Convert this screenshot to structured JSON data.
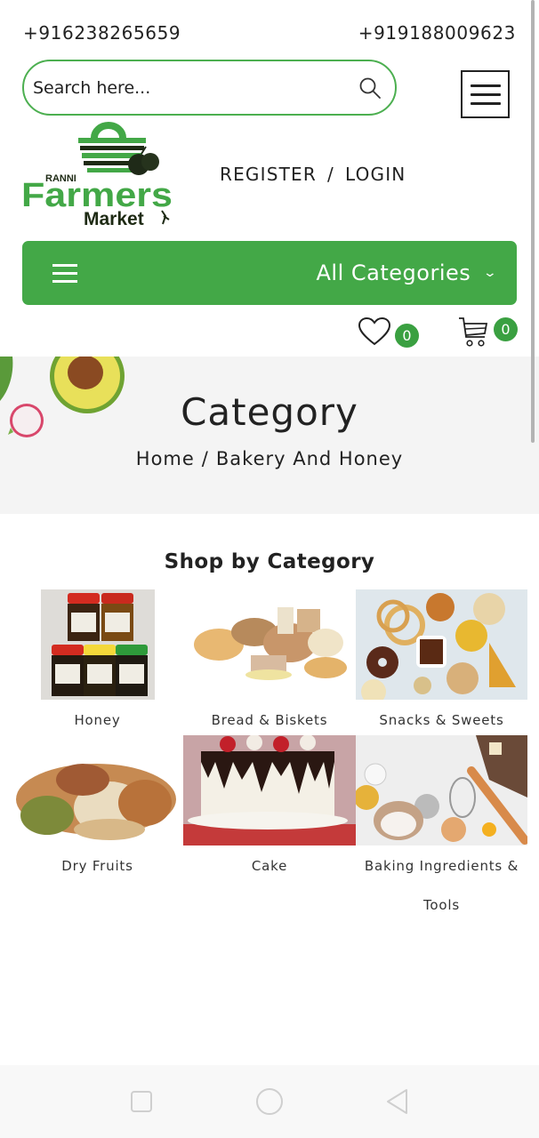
{
  "contact": {
    "phone_left": "+916238265659",
    "phone_right": "+919188009623"
  },
  "search": {
    "placeholder": "Search here...",
    "value": "",
    "icon": "search-icon"
  },
  "header": {
    "menu_icon": "hamburger-icon",
    "logo": {
      "top_text": "RANNI",
      "main_text": "Farmers",
      "sub_text": "Market"
    },
    "register_label": "REGISTER",
    "separator": "/",
    "login_label": "LOGIN"
  },
  "category_bar": {
    "label": "All Categories",
    "chevron": "⌄"
  },
  "counters": {
    "wishlist_count": "0",
    "cart_count": "0"
  },
  "hero": {
    "title": "Category",
    "breadcrumb": [
      {
        "label": "Home"
      },
      {
        "label": "Bakery And Honey"
      }
    ],
    "separator": "/"
  },
  "shop": {
    "title": "Shop by Category",
    "categories": [
      {
        "label": "Honey"
      },
      {
        "label": "Bread & Biskets"
      },
      {
        "label": "Snacks & Sweets"
      },
      {
        "label": "Dry Fruits"
      },
      {
        "label": "Cake"
      },
      {
        "label": "Baking Ingredients &",
        "label2": "Tools"
      }
    ]
  },
  "colors": {
    "brand_green": "#43a847",
    "badge_green": "#3aa041",
    "hero_bg": "#f4f4f4",
    "text_dark": "#222222"
  }
}
